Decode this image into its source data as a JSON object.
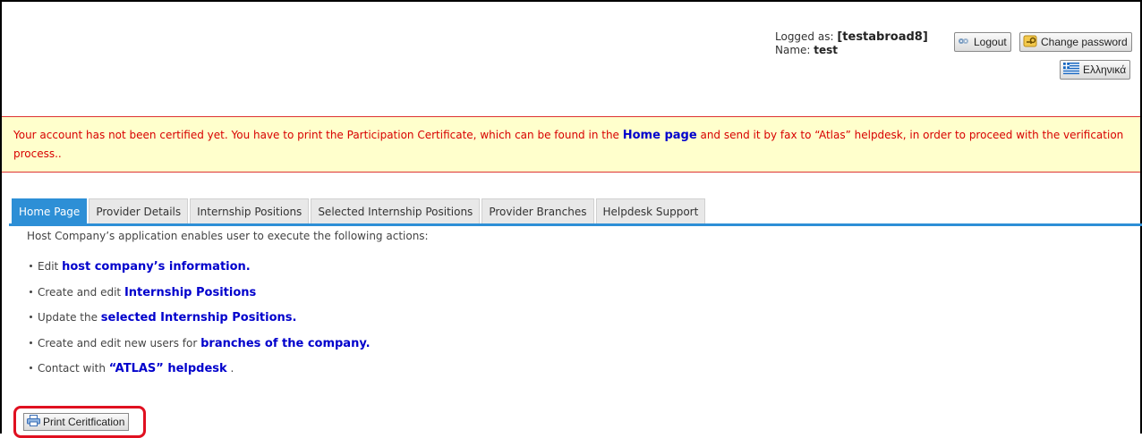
{
  "header": {
    "logged_as_label": "Logged as:",
    "username": "[testabroad8]",
    "name_label": "Name:",
    "name_value": "test",
    "logout_label": "Logout",
    "change_password_label": "Change password",
    "language_label": "Ελληνικά"
  },
  "warning": {
    "text_before": "Your account has not been certified yet. You have to print the Participation Certificate, which can be found in the ",
    "link": "Home page",
    "text_after": " and send it by fax to “Atlas” helpdesk, in order to proceed with the verification process.."
  },
  "tabs": [
    {
      "label": "Home Page",
      "active": true
    },
    {
      "label": "Provider Details",
      "active": false
    },
    {
      "label": "Internship Positions",
      "active": false
    },
    {
      "label": "Selected Internship Positions",
      "active": false
    },
    {
      "label": "Provider Branches",
      "active": false
    },
    {
      "label": "Helpdesk Support",
      "active": false
    }
  ],
  "content": {
    "intro": "Host Company’s application enables user to execute the following actions:",
    "actions": [
      {
        "text": "Edit ",
        "link": "host company’s information.",
        "after": ""
      },
      {
        "text": "Create and edit ",
        "link": "Internship Positions",
        "after": ""
      },
      {
        "text": "Update the ",
        "link": "selected Internship Positions.",
        "after": ""
      },
      {
        "text": "Create and edit new users for ",
        "link": "branches of the company.",
        "after": ""
      },
      {
        "text": "Contact with ",
        "link": "“ATLAS” helpdesk",
        "after": " ."
      }
    ],
    "print_button": "Print Ceritfication"
  },
  "colors": {
    "accent": "#2d8fd6",
    "warning_bg": "#ffffcc",
    "warning_text": "#d80000",
    "link": "#0000cc",
    "highlight": "#e01020"
  }
}
